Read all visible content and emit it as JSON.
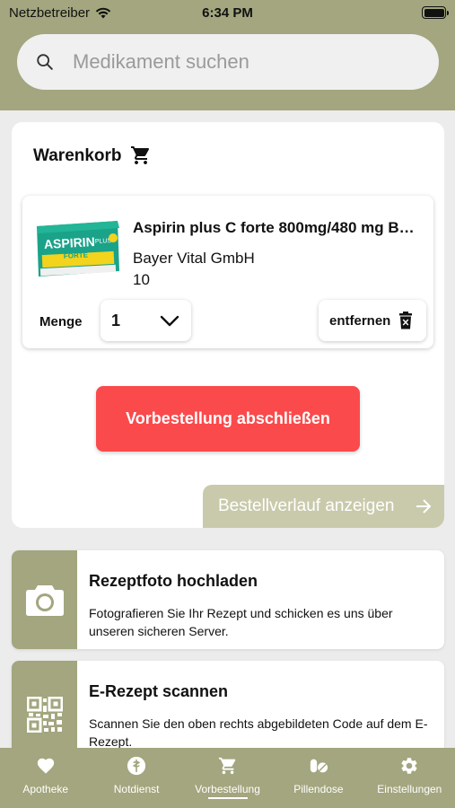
{
  "status_bar": {
    "carrier": "Netzbetreiber",
    "time": "6:34 PM"
  },
  "search": {
    "placeholder": "Medikament suchen"
  },
  "cart": {
    "title": "Warenkorb",
    "item": {
      "name": "Aspirin plus C forte 800mg/480 mg Bra...",
      "manufacturer": "Bayer Vital GmbH",
      "pack_size": "10",
      "image_text": {
        "brand": "ASPIRIN",
        "plus": "PLUS",
        "forte": "FORTE"
      },
      "quantity_label": "Menge",
      "quantity_value": "1",
      "remove_label": "entfernen"
    },
    "order_button": "Vorbestellung abschließen",
    "history_button": "Bestellverlauf anzeigen"
  },
  "features": [
    {
      "title": "Rezeptfoto hochladen",
      "text": "Fotografieren Sie Ihr Rezept und schicken es uns über unseren sicheren Server.",
      "icon": "camera-icon"
    },
    {
      "title": "E-Rezept scannen",
      "text": "Scannen Sie den oben rechts abgebildeten Code auf dem E-Rezept.",
      "icon": "qr-code-icon"
    }
  ],
  "tabs": [
    {
      "label": "Apotheke",
      "icon": "heart-icon",
      "active": false
    },
    {
      "label": "Notdienst",
      "icon": "emergency-icon",
      "active": false
    },
    {
      "label": "Vorbestellung",
      "icon": "cart-icon",
      "active": true
    },
    {
      "label": "Pillendose",
      "icon": "pills-icon",
      "active": false
    },
    {
      "label": "Einstellungen",
      "icon": "gear-icon",
      "active": false
    }
  ],
  "colors": {
    "brand_olive": "#a3a67e",
    "order_red": "#fb4a4c",
    "history_button": "#c9caab"
  }
}
